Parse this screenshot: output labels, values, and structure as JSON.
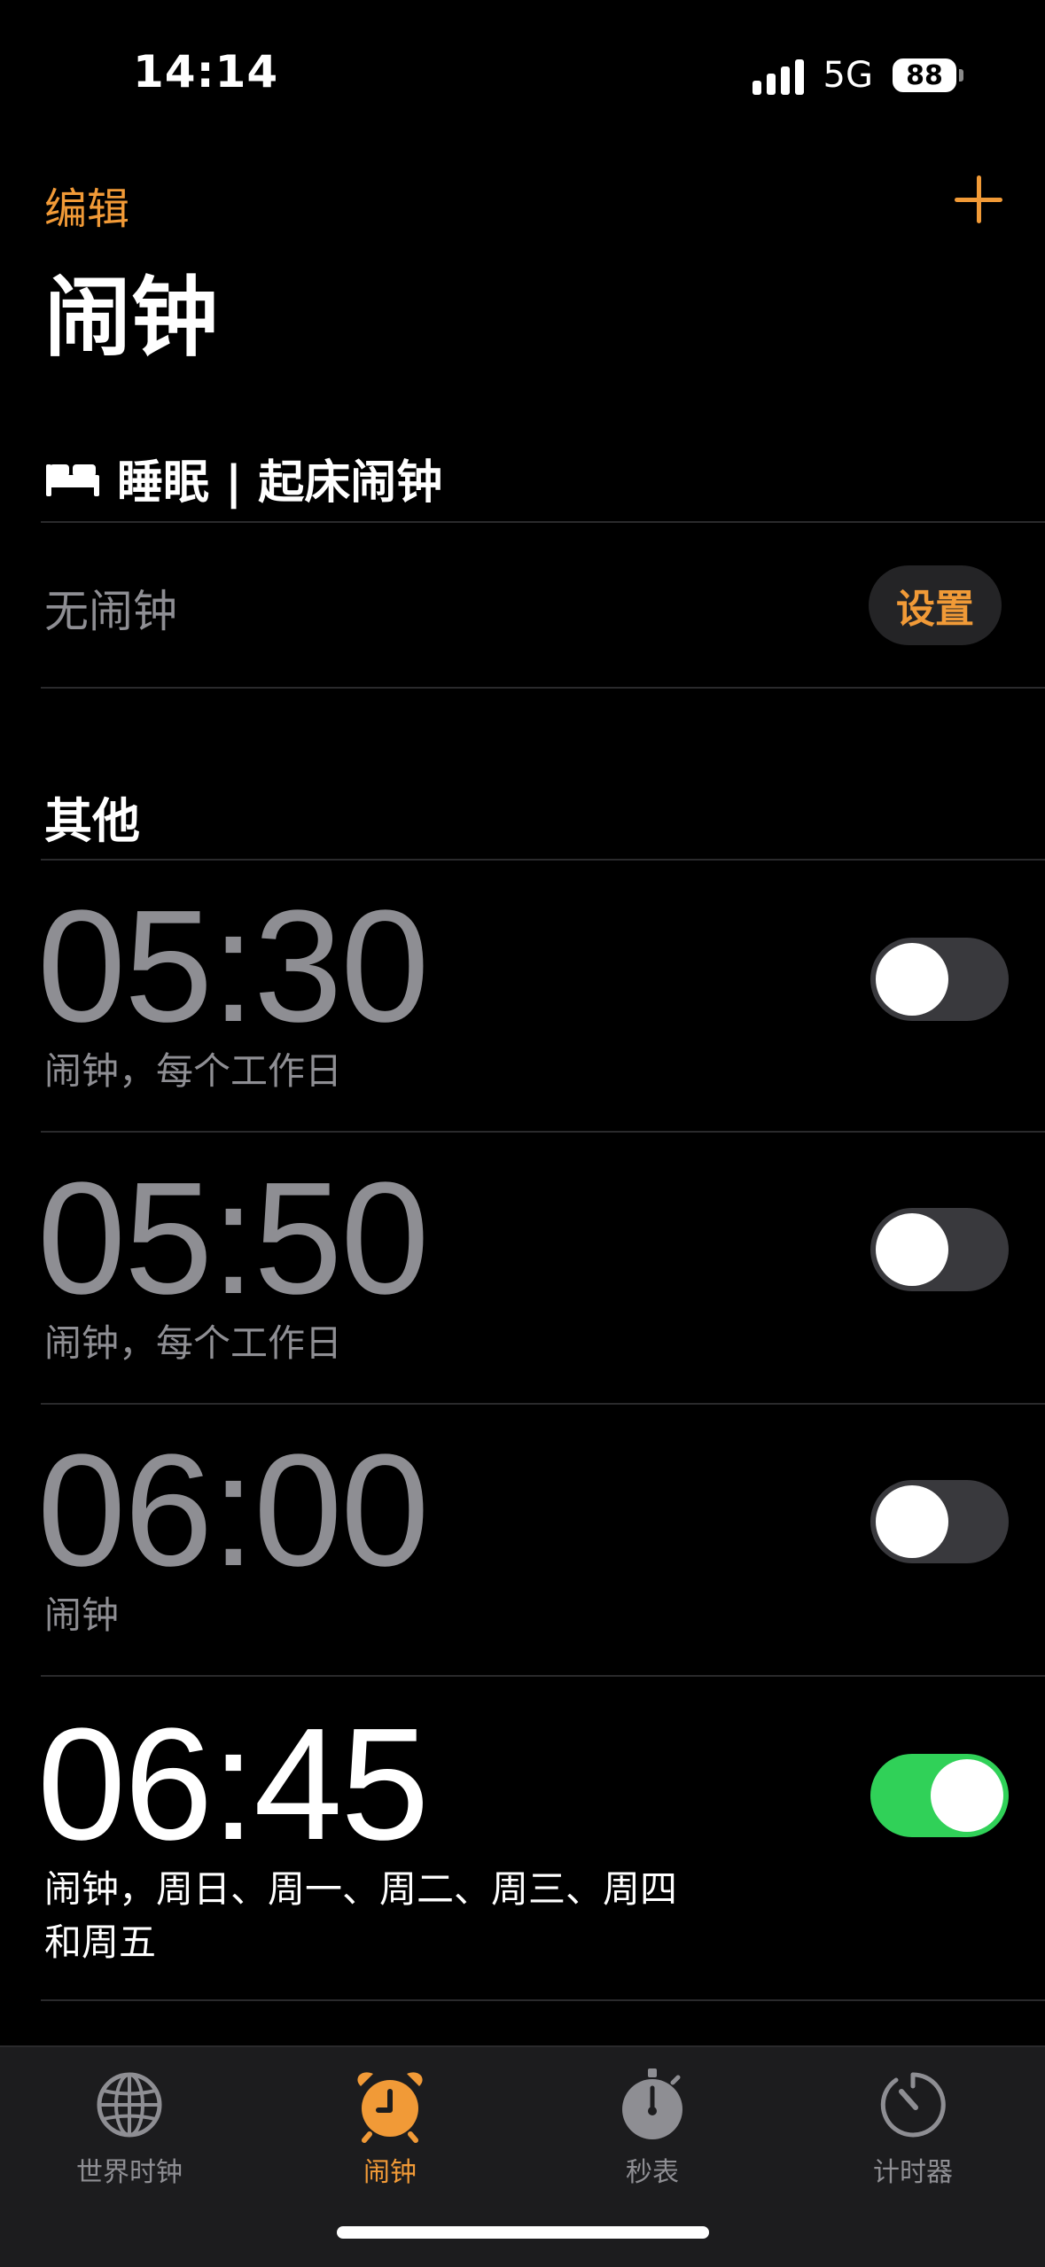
{
  "status_bar": {
    "time": "14:14",
    "network": "5G",
    "battery": "88"
  },
  "header": {
    "edit_label": "编辑",
    "title": "闹钟",
    "add_icon": "plus-icon"
  },
  "sleep_section": {
    "icon": "bed-icon",
    "title": "睡眠 | 起床闹钟",
    "status": "无闹钟",
    "setup_label": "设置"
  },
  "other_section": {
    "title": "其他",
    "alarms": [
      {
        "time": "05:30",
        "label": "闹钟，每个工作日",
        "enabled": false
      },
      {
        "time": "05:50",
        "label": "闹钟，每个工作日",
        "enabled": false
      },
      {
        "time": "06:00",
        "label": "闹钟",
        "enabled": false
      },
      {
        "time": "06:45",
        "label_line1": "闹钟，周日、周一、周二、周三、周四",
        "label_line2": "和周五",
        "enabled": true
      }
    ]
  },
  "tab_bar": {
    "tabs": [
      {
        "label": "世界时钟",
        "icon": "globe-icon",
        "active": false
      },
      {
        "label": "闹钟",
        "icon": "alarm-clock-icon",
        "active": true
      },
      {
        "label": "秒表",
        "icon": "stopwatch-icon",
        "active": false
      },
      {
        "label": "计时器",
        "icon": "timer-icon",
        "active": false
      }
    ]
  },
  "colors": {
    "accent": "#f19a37",
    "toggle_on": "#30d158",
    "secondary_text": "#8e8e93"
  }
}
